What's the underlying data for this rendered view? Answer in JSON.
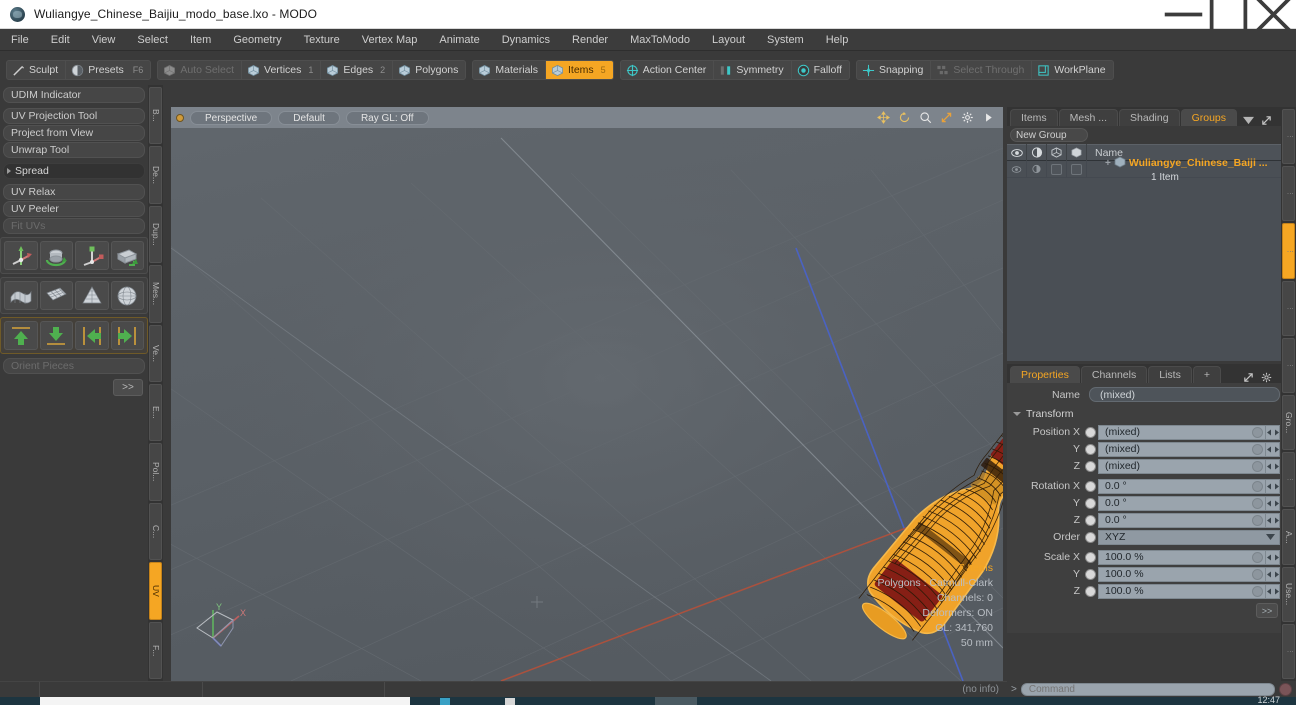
{
  "window": {
    "title": "Wuliangye_Chinese_Baijiu_modo_base.lxo - MODO",
    "app_icon": "modo-sphere-icon",
    "minimize": "minimize-icon",
    "maximize": "maximize-icon",
    "close": "close-icon"
  },
  "menubar": {
    "items": [
      "File",
      "Edit",
      "View",
      "Select",
      "Item",
      "Geometry",
      "Texture",
      "Vertex Map",
      "Animate",
      "Dynamics",
      "Render",
      "MaxToModo",
      "Layout",
      "System",
      "Help"
    ]
  },
  "toolbar": {
    "group1": [
      {
        "label": "Sculpt",
        "icon": "pencil-icon",
        "key": "",
        "state": "normal",
        "num": ""
      },
      {
        "label": "Presets",
        "icon": "sphere-icon",
        "key": "F6",
        "state": "normal",
        "num": ""
      }
    ],
    "group2": [
      {
        "label": "Auto Select",
        "icon": "cube-grey-icon",
        "key": "",
        "state": "disabled",
        "num": ""
      },
      {
        "label": "Vertices",
        "icon": "cube-blue-icon",
        "key": "",
        "state": "normal",
        "num": "1"
      },
      {
        "label": "Edges",
        "icon": "cube-blue-icon",
        "key": "",
        "state": "normal",
        "num": "2"
      },
      {
        "label": "Polygons",
        "icon": "cube-blue-icon",
        "key": "",
        "state": "normal",
        "num": ""
      }
    ],
    "group3": [
      {
        "label": "Materials",
        "icon": "cube-blue-icon",
        "key": "",
        "state": "normal",
        "num": ""
      },
      {
        "label": "Items",
        "icon": "cube-blue-icon",
        "key": "",
        "state": "active",
        "num": "5"
      }
    ],
    "group4": [
      {
        "label": "Action Center",
        "icon": "target-icon",
        "key": "",
        "state": "normal",
        "num": ""
      },
      {
        "label": "Symmetry",
        "icon": "symmetry-icon",
        "key": "",
        "state": "normal",
        "num": ""
      },
      {
        "label": "Falloff",
        "icon": "falloff-icon",
        "key": "",
        "state": "normal",
        "num": ""
      }
    ],
    "group5": [
      {
        "label": "Snapping",
        "icon": "snapping-icon",
        "key": "",
        "state": "normal",
        "num": ""
      },
      {
        "label": "Select Through",
        "icon": "select-through-icon",
        "key": "",
        "state": "disabled",
        "num": ""
      },
      {
        "label": "WorkPlane",
        "icon": "workplane-icon",
        "key": "",
        "state": "normal",
        "num": ""
      }
    ]
  },
  "left_panel": {
    "rows": [
      {
        "label": "UDIM Indicator",
        "type": "item",
        "state": "normal"
      },
      {
        "label": "UV Projection Tool",
        "type": "item",
        "state": "normal"
      },
      {
        "label": "Project from View",
        "type": "item",
        "state": "normal"
      },
      {
        "label": "Unwrap Tool",
        "type": "item",
        "state": "normal"
      },
      {
        "label": "Spread",
        "type": "header",
        "state": "normal"
      },
      {
        "label": "UV Relax",
        "type": "item",
        "state": "normal"
      },
      {
        "label": "UV Peeler",
        "type": "item",
        "state": "normal"
      },
      {
        "label": "Fit UVs",
        "type": "item",
        "state": "disabled"
      }
    ],
    "icon_rows": [
      [
        "move-uv-icon",
        "rotate-uv-icon",
        "scale-uv-icon",
        "flip-uv-icon"
      ],
      [
        "relax-uv-icon",
        "grid-uv-icon",
        "cone-uv-icon",
        "sphere-uv-icon"
      ],
      [
        "align-up-icon",
        "align-down-icon",
        "align-left-icon",
        "align-right-icon"
      ]
    ],
    "orient_pieces": {
      "label": "Orient Pieces",
      "state": "disabled"
    },
    "more_button": ">>",
    "vertical_tabs": [
      {
        "label": "B...",
        "active": false
      },
      {
        "label": "De...",
        "active": false
      },
      {
        "label": "Dup...",
        "active": false
      },
      {
        "label": "Mes...",
        "active": false
      },
      {
        "label": "Ve...",
        "active": false
      },
      {
        "label": "E...",
        "active": false
      },
      {
        "label": "Pol...",
        "active": false
      },
      {
        "label": "C...",
        "active": false
      },
      {
        "label": "UV",
        "active": true
      },
      {
        "label": "F...",
        "active": false
      }
    ]
  },
  "viewport": {
    "dot": "viewport-state-dot",
    "pills": [
      "Perspective",
      "Default",
      "Ray GL: Off"
    ],
    "tools": [
      "move-view-icon",
      "rotate-view-icon",
      "zoom-view-icon",
      "fit-view-icon",
      "viewport-settings-icon",
      "viewport-more-icon"
    ],
    "info": {
      "items": "7 Items",
      "polygons": "Polygons : Catmull-Clark",
      "channels": "Channels: 0",
      "deformers": "Deformers: ON",
      "gl": "GL: 341,760",
      "scale": "50 mm"
    },
    "axis_gizmo": {
      "x": "X",
      "y": "Y",
      "z": "Z"
    }
  },
  "groups_panel": {
    "tabs": [
      {
        "label": "Items",
        "active": false
      },
      {
        "label": "Mesh ...",
        "active": false
      },
      {
        "label": "Shading",
        "active": false
      },
      {
        "label": "Groups",
        "active": true
      }
    ],
    "tab_caret": "chevron-down-icon",
    "expand_icon": "expand-panel-icon",
    "more_icon": "panel-more-icon",
    "new_group_label": "New Group",
    "column_icons": [
      "eye-icon",
      "shade-icon",
      "wireframe-icon",
      "render-icon"
    ],
    "name_column": "Name",
    "rows": [
      {
        "name": "Wuliangye_Chinese_Baiji ...",
        "sub": "1 Item",
        "icon": "group-icon"
      }
    ]
  },
  "properties_panel": {
    "tabs": [
      {
        "label": "Properties",
        "active": true
      },
      {
        "label": "Channels",
        "active": false
      },
      {
        "label": "Lists",
        "active": false
      },
      {
        "label": "+",
        "active": false
      }
    ],
    "expand_icon": "expand-panel-icon",
    "gear_icon": "gear-icon",
    "more_icon": "panel-more-icon",
    "name_label": "Name",
    "name_value": "(mixed)",
    "transform_section": "Transform",
    "fields": [
      {
        "label": "Position X",
        "value": "(mixed)",
        "type": "text"
      },
      {
        "label": "Y",
        "value": "(mixed)",
        "type": "text"
      },
      {
        "label": "Z",
        "value": "(mixed)",
        "type": "text"
      },
      {
        "label": "Rotation X",
        "value": "0.0 °",
        "type": "text"
      },
      {
        "label": "Y",
        "value": "0.0 °",
        "type": "text"
      },
      {
        "label": "Z",
        "value": "0.0 °",
        "type": "text"
      },
      {
        "label": "Order",
        "value": "XYZ",
        "type": "dropdown"
      },
      {
        "label": "Scale X",
        "value": "100.0 %",
        "type": "text"
      },
      {
        "label": "Y",
        "value": "100.0 %",
        "type": "text"
      },
      {
        "label": "Z",
        "value": "100.0 %",
        "type": "text"
      }
    ],
    "more_button": ">>",
    "vertical_tabs": [
      {
        "label": "",
        "active": false
      },
      {
        "label": "",
        "active": false
      },
      {
        "label": "",
        "active": true
      },
      {
        "label": "",
        "active": false
      },
      {
        "label": "",
        "active": false
      },
      {
        "label": "Gro...",
        "active": false
      },
      {
        "label": "",
        "active": false
      },
      {
        "label": "A...",
        "active": false
      },
      {
        "label": "Use...",
        "active": false
      },
      {
        "label": "",
        "active": false
      }
    ]
  },
  "command_bar": {
    "prompt": ">",
    "placeholder": "Command",
    "record_icon": "record-icon"
  },
  "status_bar": {
    "no_info": "(no info)"
  },
  "taskbar": {
    "clock": "12:47"
  },
  "colors": {
    "accent": "#f5a623",
    "panel_bg": "#3a3a3a",
    "viewport_bg": "#5b6066",
    "field_bg": "#9aa4ad",
    "wireframe": "#f5a623"
  }
}
